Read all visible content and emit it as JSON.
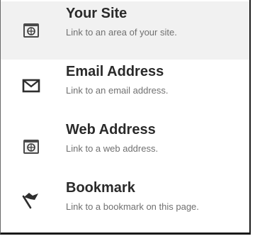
{
  "link_menu": {
    "items": [
      {
        "title": "Your Site",
        "description": "Link to an area of your site.",
        "icon": "site-icon",
        "selected": true
      },
      {
        "title": "Email Address",
        "description": "Link to an email address.",
        "icon": "envelope-icon",
        "selected": false
      },
      {
        "title": "Web Address",
        "description": "Link to a web address.",
        "icon": "globe-window-icon",
        "selected": false
      },
      {
        "title": "Bookmark",
        "description": "Link to a bookmark on this page.",
        "icon": "flag-icon",
        "selected": false
      }
    ]
  }
}
